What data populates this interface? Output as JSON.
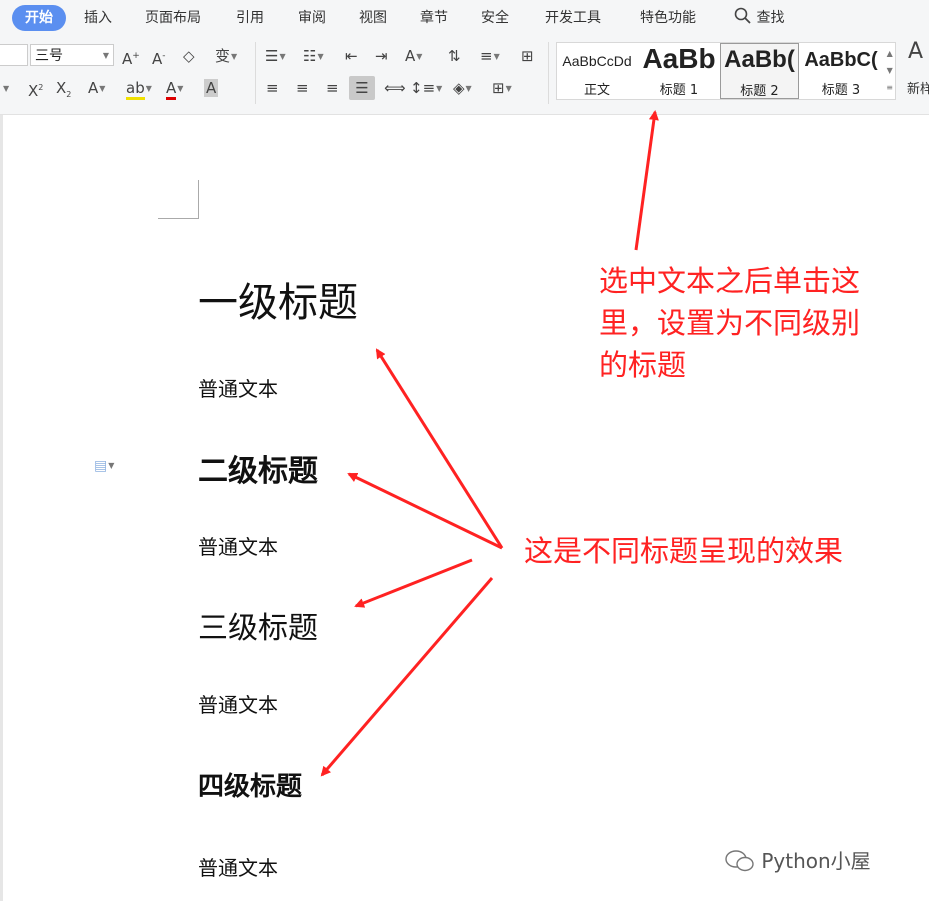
{
  "menu": {
    "active": "开始",
    "items": [
      "插入",
      "页面布局",
      "引用",
      "审阅",
      "视图",
      "章节",
      "安全",
      "开发工具",
      "特色功能"
    ],
    "search_label": "查找"
  },
  "ribbon": {
    "font_size": "三号",
    "styles": [
      {
        "preview": "AaBbCcDd",
        "label": "正文"
      },
      {
        "preview": "AaBb",
        "label": "标题 1"
      },
      {
        "preview": "AaBb(",
        "label": "标题 2"
      },
      {
        "preview": "AaBbC(",
        "label": "标题 3"
      }
    ],
    "new_style_label": "新样"
  },
  "document": {
    "h1": "一级标题",
    "p1": "普通文本",
    "h2": "二级标题",
    "p2": "普通文本",
    "h3": "三级标题",
    "p3": "普通文本",
    "h4": "四级标题",
    "p4": "普通文本"
  },
  "annotations": {
    "callout_top": [
      "选中文本之后单击这",
      "里，设置为不同级别",
      "的标题"
    ],
    "callout_middle": "这是不同标题呈现的效果"
  },
  "watermark": "Python小屋",
  "colors": {
    "accent": "#5b8ff0",
    "annotation": "#ff2222"
  }
}
